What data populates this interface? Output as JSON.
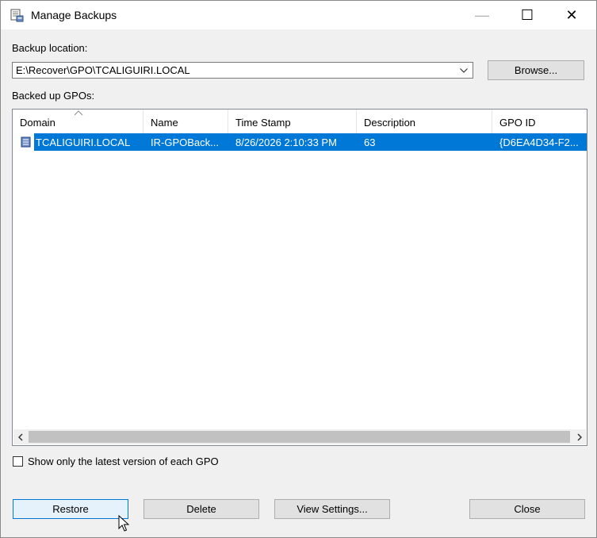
{
  "window": {
    "title": "Manage Backups"
  },
  "titlebar": {
    "minimize": "—",
    "maximize": "☐",
    "close": "✕"
  },
  "location": {
    "label": "Backup location:",
    "path": "E:\\Recover\\GPO\\TCALIGUIRI.LOCAL",
    "browse_label": "Browse..."
  },
  "backups": {
    "label": "Backed up GPOs:",
    "columns": [
      "Domain",
      "Name",
      "Time Stamp",
      "Description",
      "GPO ID"
    ],
    "rows": [
      {
        "domain": "TCALIGUIRI.LOCAL",
        "name": "IR-GPOBack...",
        "time_stamp": "8/26/2026 2:10:33 PM",
        "description": "63",
        "gpo_id": "{D6EA4D34-F2..."
      }
    ]
  },
  "options": {
    "latest_only_label": "Show only the latest version of each GPO",
    "latest_only_checked": false
  },
  "buttons": {
    "restore": "Restore",
    "delete": "Delete",
    "view_settings": "View Settings...",
    "close": "Close"
  },
  "colors": {
    "selection": "#0078d7",
    "window_bg": "#f0f0f0"
  }
}
